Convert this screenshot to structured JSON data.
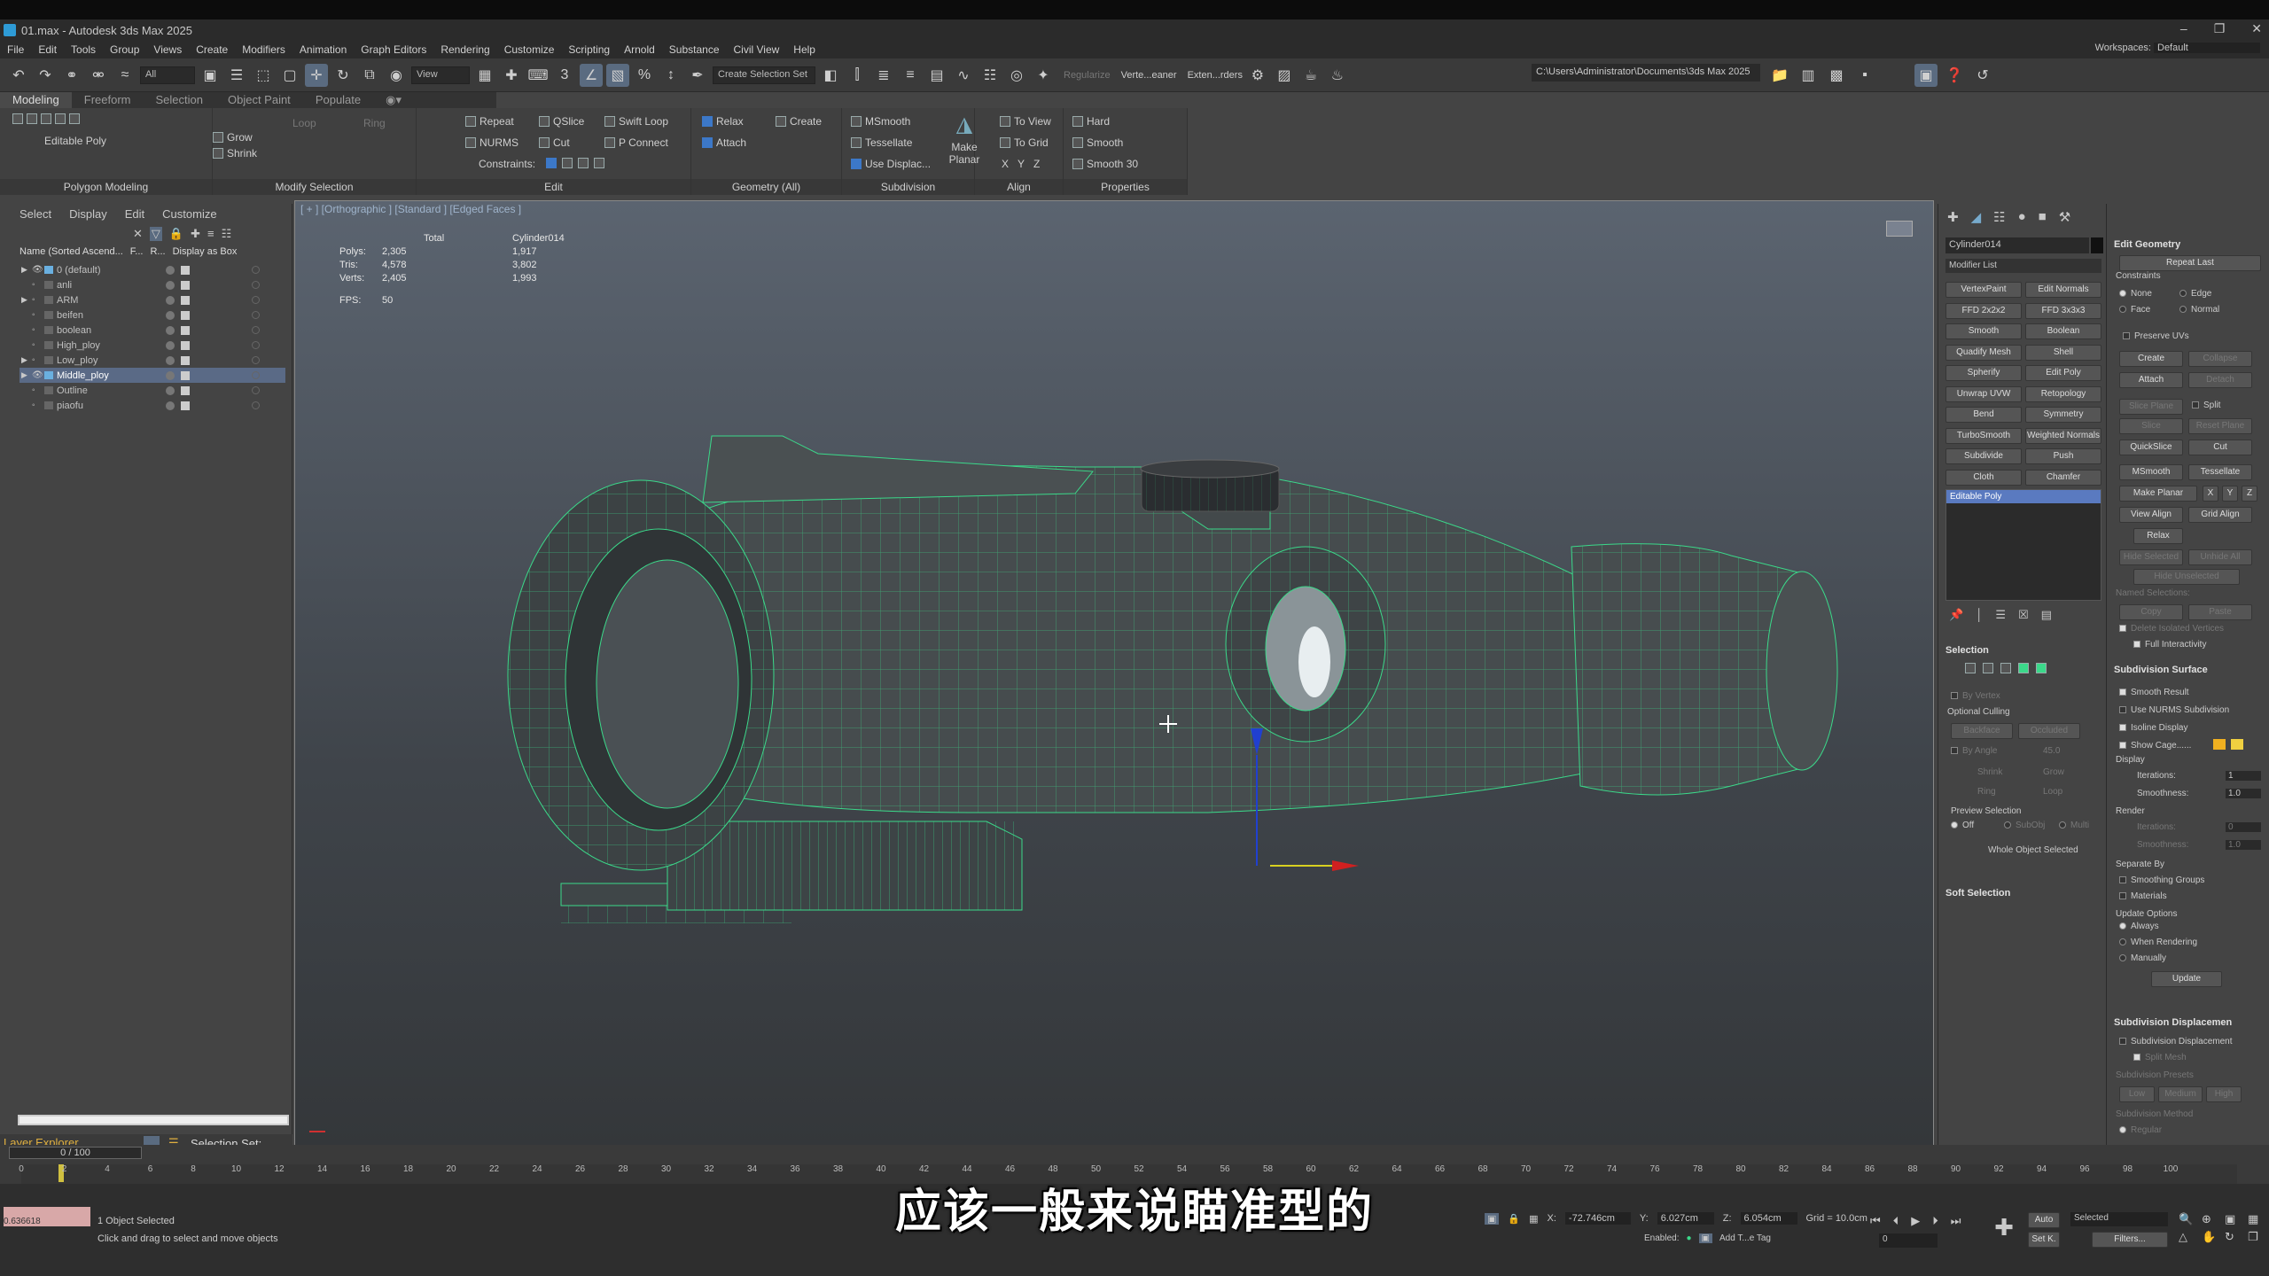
{
  "window": {
    "title": "01.max - Autodesk 3ds Max 2025"
  },
  "menu": [
    "File",
    "Edit",
    "Tools",
    "Group",
    "Views",
    "Create",
    "Modifiers",
    "Animation",
    "Graph Editors",
    "Rendering",
    "Customize",
    "Scripting",
    "Arnold",
    "Substance",
    "Civil View",
    "Help"
  ],
  "workspace": {
    "label": "Workspaces:",
    "value": "Default"
  },
  "toolbar": {
    "filter": "All",
    "ref_coord": "View",
    "selection_set": "Create Selection Set",
    "texts": [
      "Regularize",
      "Verte...eaner",
      "Exten...rders"
    ],
    "project_path": "C:\\Users\\Administrator\\Documents\\3ds Max 2025"
  },
  "ribbon": {
    "tabs": [
      "Modeling",
      "Freeform",
      "Selection",
      "Object Paint",
      "Populate"
    ],
    "editable_poly": "Editable Poly",
    "grow": "Grow",
    "shrink": "Shrink",
    "loop": "Loop",
    "ring": "Ring",
    "edit_items": [
      "Repeat",
      "QSlice",
      "Swift Loop",
      "NURMS",
      "Cut",
      "P Connect"
    ],
    "constraints": "Constraints:",
    "geometry_items": [
      "Relax",
      "Create",
      "Attach"
    ],
    "subdiv_items": [
      "MSmooth",
      "Tessellate",
      "Use Displac..."
    ],
    "make_planar": "Make Planar",
    "align_items": [
      "To View",
      "To Grid",
      "X",
      "Y",
      "Z"
    ],
    "props_items": [
      "Hard",
      "Smooth",
      "Smooth 30"
    ],
    "groups": [
      "Polygon Modeling",
      "Modify Selection",
      "Edit",
      "Geometry (All)",
      "Subdivision",
      "Align",
      "Properties"
    ]
  },
  "layers": {
    "menu": [
      "Select",
      "Display",
      "Edit",
      "Customize"
    ],
    "columns": [
      "Name (Sorted Ascend...",
      "F...",
      "R...",
      "Display as Box"
    ],
    "rows": [
      "0 (default)",
      "anli",
      "ARM",
      "beifen",
      "boolean",
      "High_ploy",
      "Low_ploy",
      "Middle_ploy",
      "Outline",
      "piaofu"
    ],
    "footer": "Layer Explorer",
    "selection_set": "Selection Set:"
  },
  "viewport": {
    "label": "[ + ] [Orthographic ] [Standard ] [Edged Faces ]",
    "stats": {
      "headers": [
        "Total",
        "Cylinder014"
      ],
      "rows": [
        [
          "Polys:",
          "2,305",
          "1,917"
        ],
        [
          "Tris:",
          "4,578",
          "3,802"
        ],
        [
          "Verts:",
          "2,405",
          "1,993"
        ]
      ],
      "fps_label": "FPS:",
      "fps": "50"
    }
  },
  "modifier_panel": {
    "object_name": "Cylinder014",
    "modifier_list": "Modifier List",
    "buttons": [
      [
        "VertexPaint",
        "Edit Normals"
      ],
      [
        "FFD 2x2x2",
        "FFD 3x3x3"
      ],
      [
        "Smooth",
        "Boolean"
      ],
      [
        "Quadify Mesh",
        "Shell"
      ],
      [
        "Spherify",
        "Edit Poly"
      ],
      [
        "Unwrap UVW",
        "Retopology"
      ],
      [
        "Bend",
        "Symmetry"
      ],
      [
        "TurboSmooth",
        "Weighted Normals"
      ],
      [
        "Subdivide",
        "Push"
      ],
      [
        "Cloth",
        "Chamfer"
      ]
    ],
    "stack_item": "Editable Poly",
    "selection": {
      "title": "Selection",
      "by_vertex": "By Vertex",
      "optional_culling": "Optional Culling",
      "backface": "Backface",
      "occluded": "Occluded",
      "by_angle": "By Angle",
      "angle": "45.0",
      "shrink": "Shrink",
      "grow": "Grow",
      "ring": "Ring",
      "loop": "Loop",
      "preview": "Preview Selection",
      "off": "Off",
      "subobj": "SubObj",
      "multi": "Multi",
      "status": "Whole Object Selected"
    },
    "soft_selection": "Soft Selection"
  },
  "edit_geometry": {
    "title": "Edit Geometry",
    "repeat_last": "Repeat Last",
    "constraints": "Constraints",
    "none": "None",
    "edge": "Edge",
    "face": "Face",
    "normal": "Normal",
    "preserve_uvs": "Preserve UVs",
    "create": "Create",
    "collapse": "Collapse",
    "attach": "Attach",
    "detach": "Detach",
    "slice_plane": "Slice Plane",
    "split": "Split",
    "slice": "Slice",
    "reset_plane": "Reset Plane",
    "quickslice": "QuickSlice",
    "cut": "Cut",
    "msmooth": "MSmooth",
    "tessellate": "Tessellate",
    "make_planar": "Make Planar",
    "x": "X",
    "y": "Y",
    "z": "Z",
    "view_align": "View Align",
    "grid_align": "Grid Align",
    "relax": "Relax",
    "hide_selected": "Hide Selected",
    "unhide_all": "Unhide All",
    "hide_unselected": "Hide Unselected",
    "named_selections": "Named Selections:",
    "copy": "Copy",
    "paste": "Paste",
    "delete_isolated": "Delete Isolated Vertices",
    "full_interactivity": "Full Interactivity"
  },
  "subdivision_surface": {
    "title": "Subdivision Surface",
    "smooth_result": "Smooth Result",
    "use_nurms": "Use NURMS Subdivision",
    "isoline": "Isoline Display",
    "show_cage": "Show Cage......",
    "display": "Display",
    "iterations": "Iterations:",
    "iter_val": "1",
    "smoothness": "Smoothness:",
    "smooth_val": "1.0",
    "render": "Render",
    "r_iter_val": "0",
    "r_smooth_val": "1.0",
    "separate_by": "Separate By",
    "smoothing_groups": "Smoothing Groups",
    "materials": "Materials",
    "update_options": "Update Options",
    "always": "Always",
    "when_rendering": "When Rendering",
    "manually": "Manually",
    "update": "Update"
  },
  "subdivision_disp": {
    "title": "Subdivision Displacemen",
    "check": "Subdivision Displacement",
    "split_mesh": "Split Mesh",
    "presets": "Subdivision Presets",
    "low": "Low",
    "medium": "Medium",
    "high": "High",
    "method": "Subdivision Method",
    "regular": "Regular"
  },
  "timeline": {
    "slider": "0 / 100",
    "ticks": [
      "0",
      "2",
      "4",
      "6",
      "8",
      "10",
      "12",
      "14",
      "16",
      "18",
      "20",
      "22",
      "24",
      "26",
      "28",
      "30",
      "32",
      "34",
      "36",
      "38",
      "40",
      "42",
      "44",
      "46",
      "48",
      "50",
      "52",
      "54",
      "56",
      "58",
      "60",
      "62",
      "64",
      "66",
      "68",
      "70",
      "72",
      "74",
      "76",
      "78",
      "80",
      "82",
      "84",
      "86",
      "88",
      "90",
      "92",
      "94",
      "96",
      "98",
      "100"
    ]
  },
  "status": {
    "selected": "1 Object Selected",
    "hint": "Click and drag to select and move objects",
    "coord": "0.636618",
    "x_label": "X:",
    "x": "-72.746cm",
    "y_label": "Y:",
    "y": "6.027cm",
    "z_label": "Z:",
    "z": "6.054cm",
    "grid": "Grid = 10.0cm",
    "enabled": "Enabled:",
    "add_tag": "Add T...e Tag",
    "auto": "Auto",
    "set_k": "Set K.",
    "selected_dd": "Selected",
    "filters": "Filters...",
    "frame": "0"
  },
  "subtitle": "应该一般来说瞄准型的"
}
